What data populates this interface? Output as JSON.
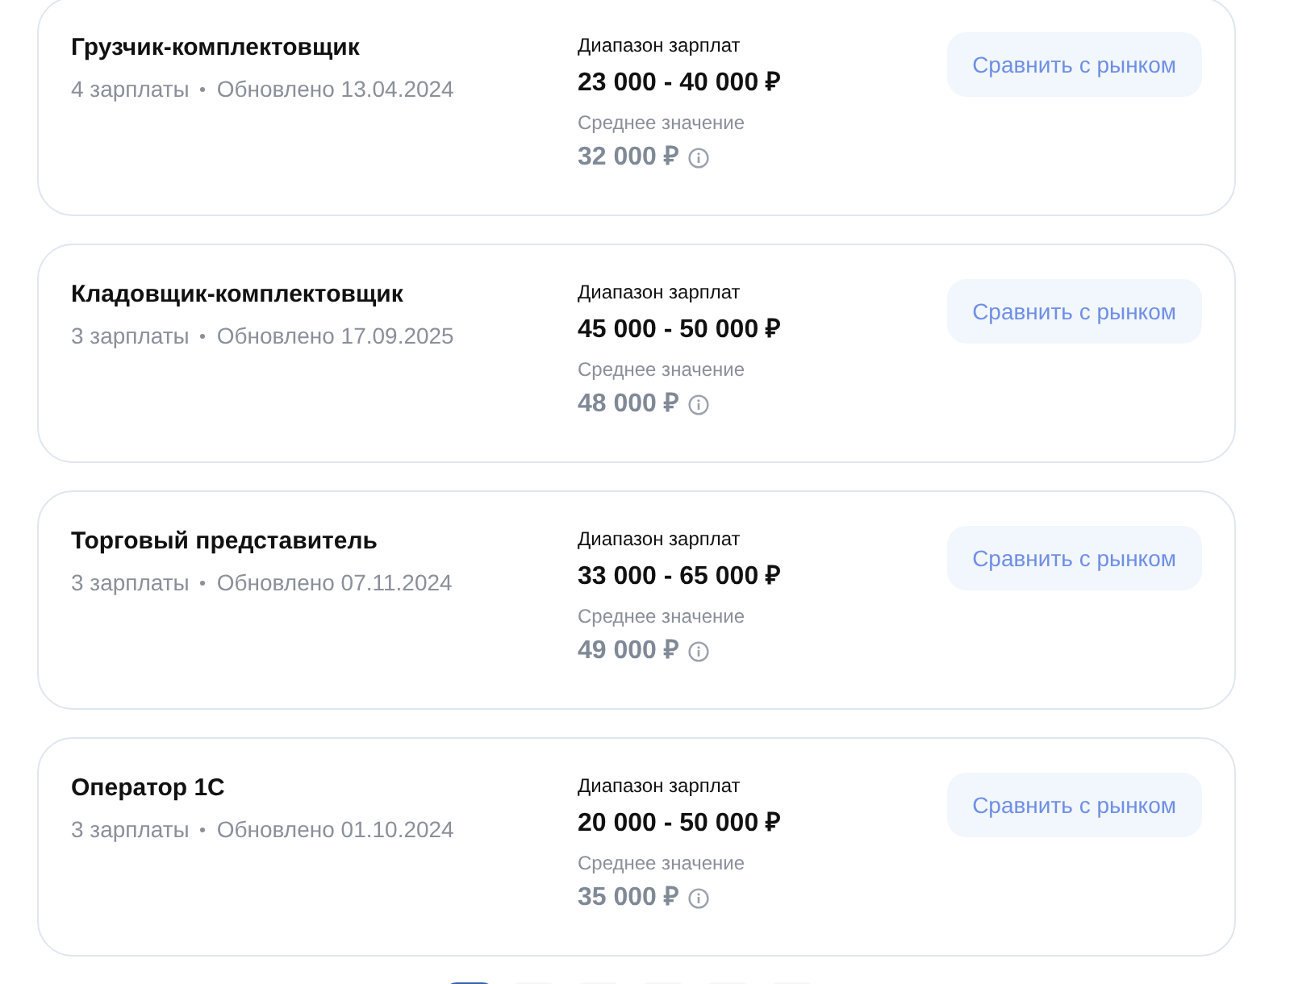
{
  "vacancies": [
    {
      "title": "Грузчик-комплектовщик",
      "count": "4 зарплаты",
      "updated": "Обновлено 13.04.2024",
      "range_label": "Диапазон зарплат",
      "range": "23 000 - 40 000",
      "currency": "₽",
      "average_label": "Среднее значение",
      "average": "32 000",
      "average_currency": "₽",
      "button": "Сравнить с рынком"
    },
    {
      "title": "Кладовщик-комплектовщик",
      "count": "3 зарплаты",
      "updated": "Обновлено 17.09.2025",
      "range_label": "Диапазон зарплат",
      "range": "45 000 - 50 000",
      "currency": "₽",
      "average_label": "Среднее значение",
      "average": "48 000",
      "average_currency": "₽",
      "button": "Сравнить с рынком"
    },
    {
      "title": "Торговый представитель",
      "count": "3 зарплаты",
      "updated": "Обновлено 07.11.2024",
      "range_label": "Диапазон зарплат",
      "range": "33 000 - 65 000",
      "currency": "₽",
      "average_label": "Среднее значение",
      "average": "49 000",
      "average_currency": "₽",
      "button": "Сравнить с рынком"
    },
    {
      "title": "Оператор 1С",
      "count": "3 зарплаты",
      "updated": "Обновлено 01.10.2024",
      "range_label": "Диапазон зарплат",
      "range": "20 000 - 50 000",
      "currency": "₽",
      "average_label": "Среднее значение",
      "average": "35 000",
      "average_currency": "₽",
      "button": "Сравнить с рынком"
    }
  ],
  "pagination": [
    {
      "selected": true
    },
    {
      "selected": false
    },
    {
      "selected": false
    },
    {
      "selected": false
    },
    {
      "selected": false
    },
    {
      "selected": false
    }
  ]
}
